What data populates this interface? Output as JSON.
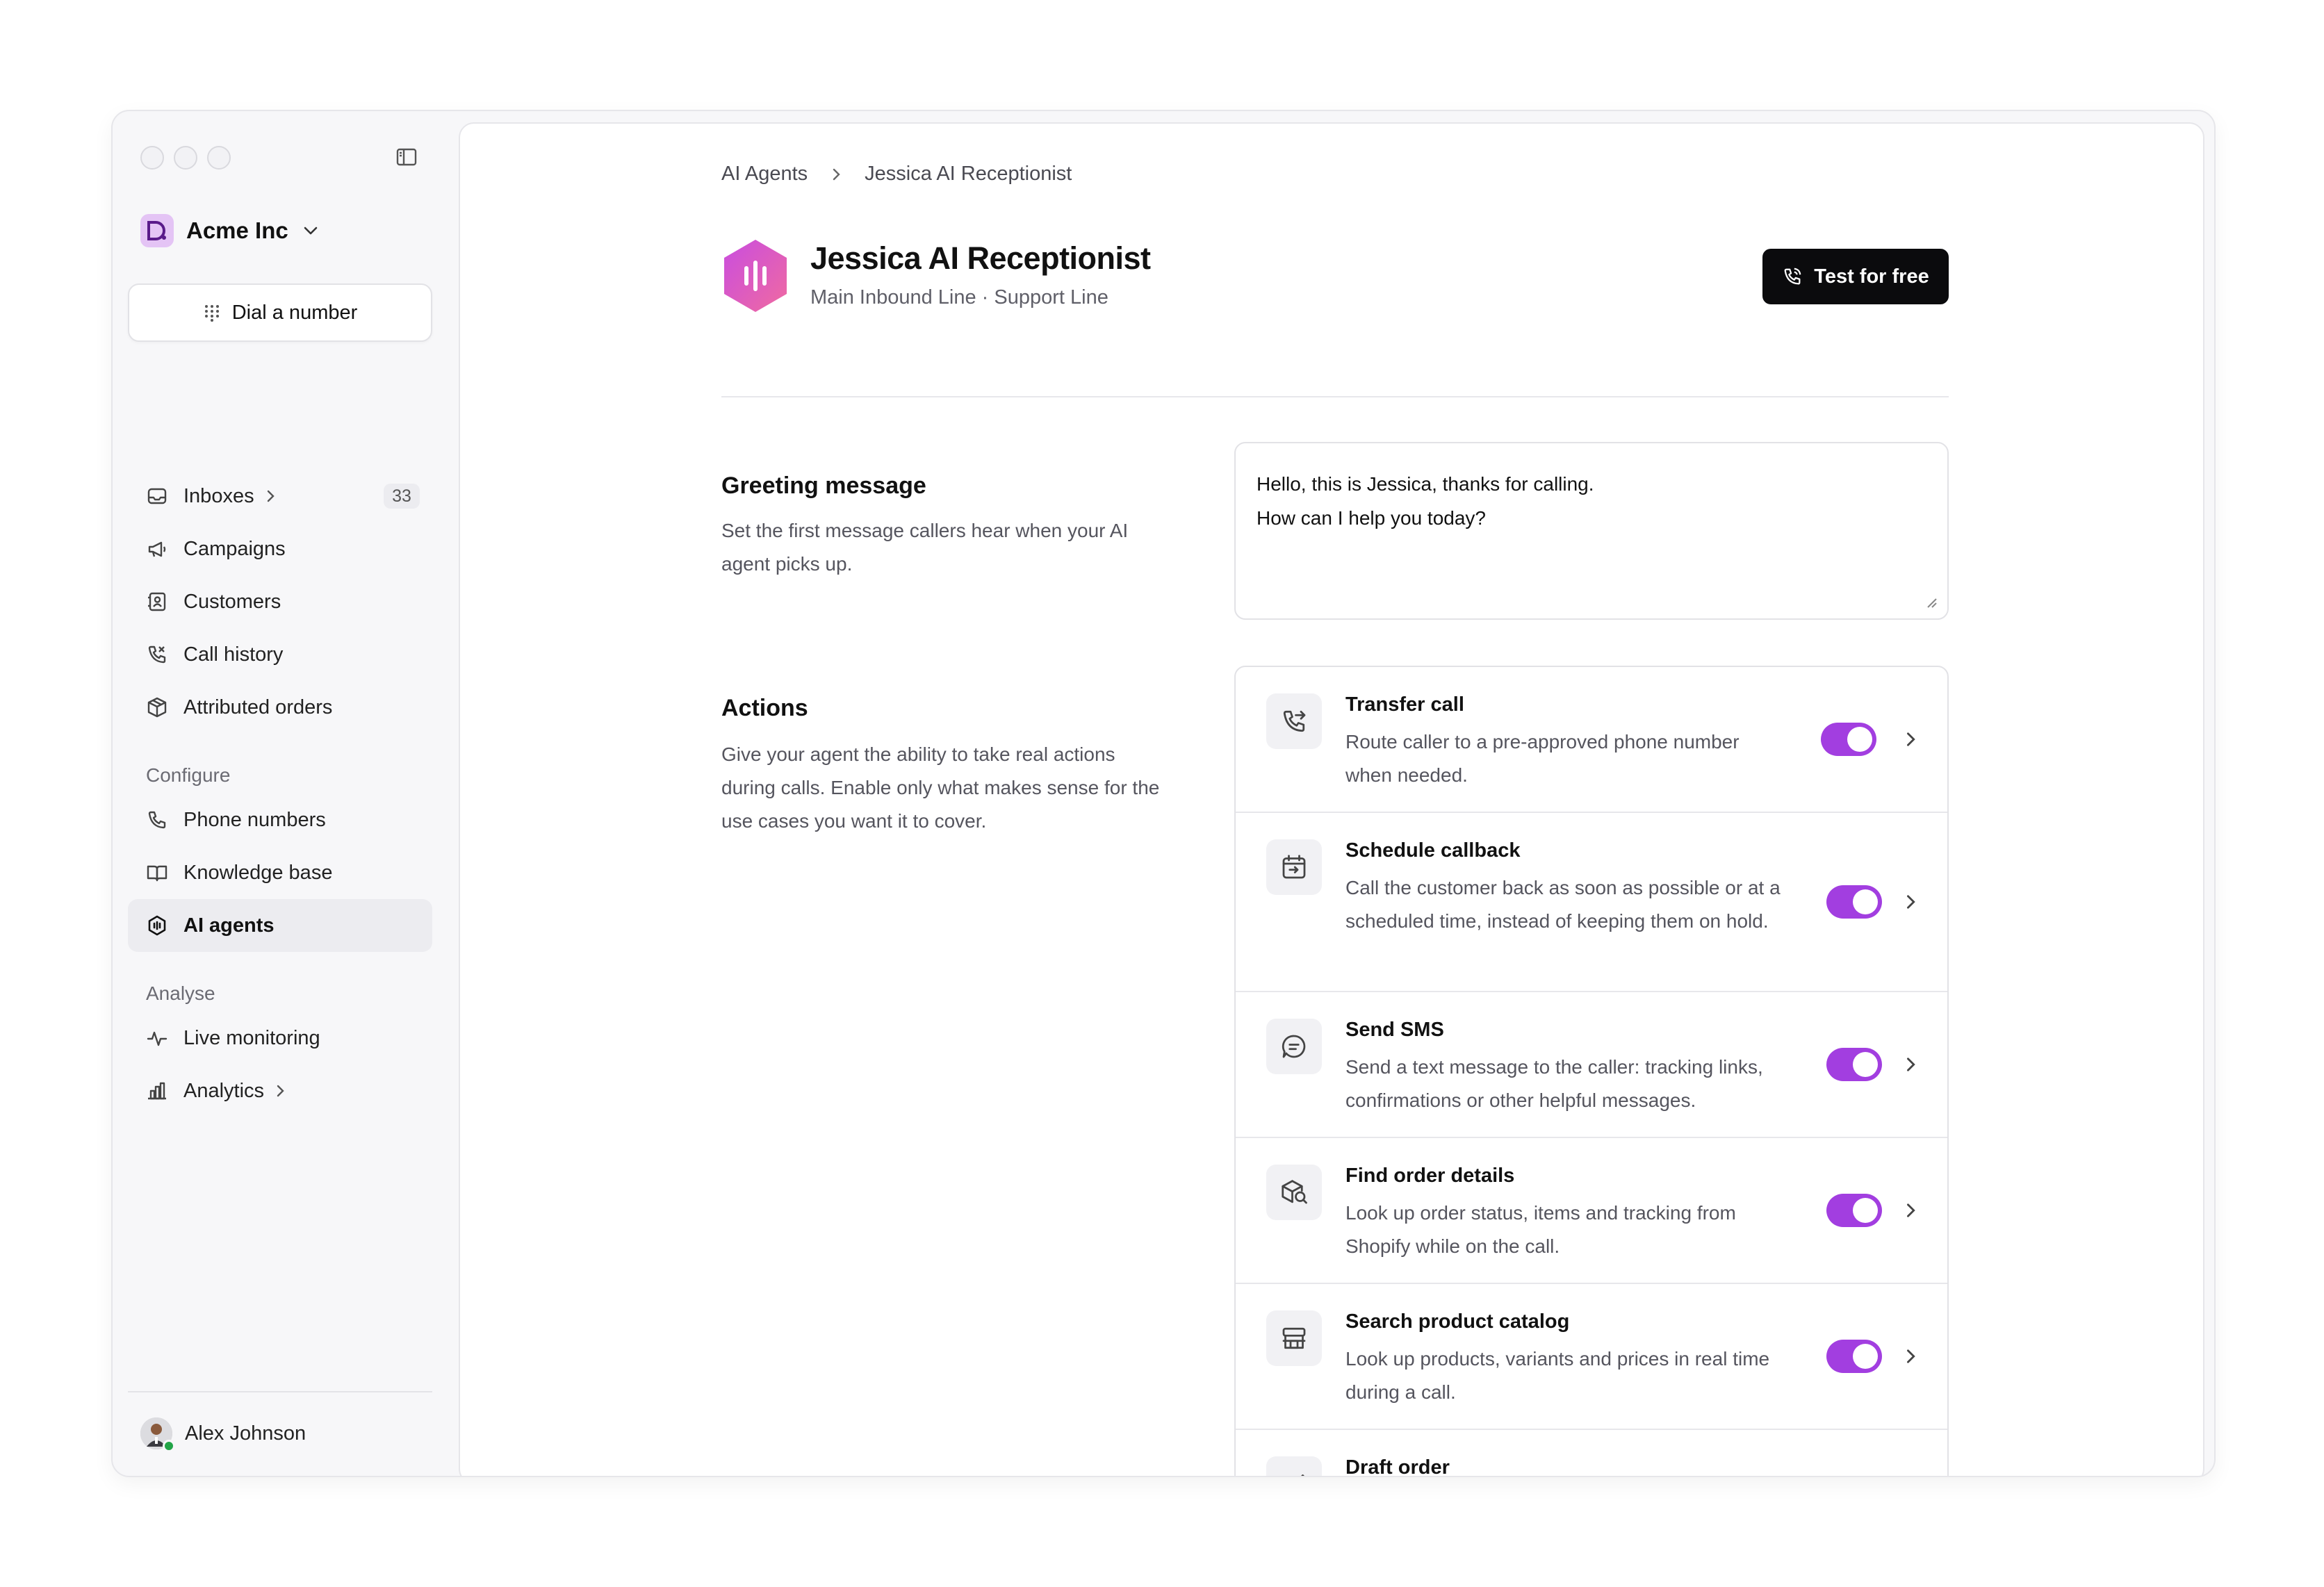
{
  "window": {
    "controls": [
      "close",
      "minimize",
      "maximize"
    ]
  },
  "sidebar": {
    "workspace": {
      "name": "Acme Inc",
      "logo_letter": "D."
    },
    "dial_button": "Dial a number",
    "nav_main": [
      {
        "label": "Inboxes",
        "icon": "inbox-icon",
        "count": "33",
        "has_chevron": true
      },
      {
        "label": "Campaigns",
        "icon": "megaphone-icon"
      },
      {
        "label": "Customers",
        "icon": "contacts-icon"
      },
      {
        "label": "Call history",
        "icon": "phone-history-icon"
      },
      {
        "label": "Attributed orders",
        "icon": "box-icon"
      }
    ],
    "configure_label": "Configure",
    "nav_configure": [
      {
        "label": "Phone numbers",
        "icon": "phone-icon"
      },
      {
        "label": "Knowledge base",
        "icon": "book-icon"
      },
      {
        "label": "AI agents",
        "icon": "ai-agent-icon",
        "active": true
      }
    ],
    "analyse_label": "Analyse",
    "nav_analyse": [
      {
        "label": "Live monitoring",
        "icon": "pulse-icon"
      },
      {
        "label": "Analytics",
        "icon": "bar-chart-icon",
        "has_chevron": true
      }
    ],
    "user": {
      "name": "Alex Johnson",
      "status": "online"
    }
  },
  "breadcrumb": [
    "AI Agents",
    "Jessica AI Receptionist"
  ],
  "agent": {
    "name": "Jessica AI Receptionist",
    "subtitle": "Main Inbound Line · Support Line",
    "test_button": "Test for free"
  },
  "greeting": {
    "title": "Greeting message",
    "description": "Set the first message callers hear when your AI agent picks up.",
    "message_line1": "Hello, this is Jessica, thanks for calling.",
    "message_line2": "How can I help you today?"
  },
  "actions_section": {
    "title": "Actions",
    "description": "Give your agent the ability to take real actions during calls. Enable only what makes sense for the use cases you want it to cover.",
    "items": [
      {
        "title": "Transfer call",
        "description": "Route caller to a pre-approved phone number when needed.",
        "icon": "phone-transfer-icon",
        "enabled": true
      },
      {
        "title": "Schedule callback",
        "description": "Call the customer back as soon as possible or at a scheduled time, instead of keeping them on hold.",
        "icon": "calendar-callback-icon",
        "enabled": true
      },
      {
        "title": "Send SMS",
        "description": "Send a text message to the caller: tracking links, confirmations or other helpful messages.",
        "icon": "message-icon",
        "enabled": true
      },
      {
        "title": "Find order details",
        "description": "Look up order status, items and tracking from Shopify while on the call.",
        "icon": "package-search-icon",
        "enabled": true
      },
      {
        "title": "Search product catalog",
        "description": "Look up products, variants and prices in real time during a call.",
        "icon": "store-icon",
        "enabled": true
      },
      {
        "title": "Draft order",
        "description": "",
        "icon": "edit-order-icon",
        "enabled": true
      }
    ]
  },
  "colors": {
    "accent": "#a23ee0",
    "primary_button": "#0b0b0d",
    "logo_gradient": [
      "#c94de0",
      "#f06aa0"
    ]
  }
}
